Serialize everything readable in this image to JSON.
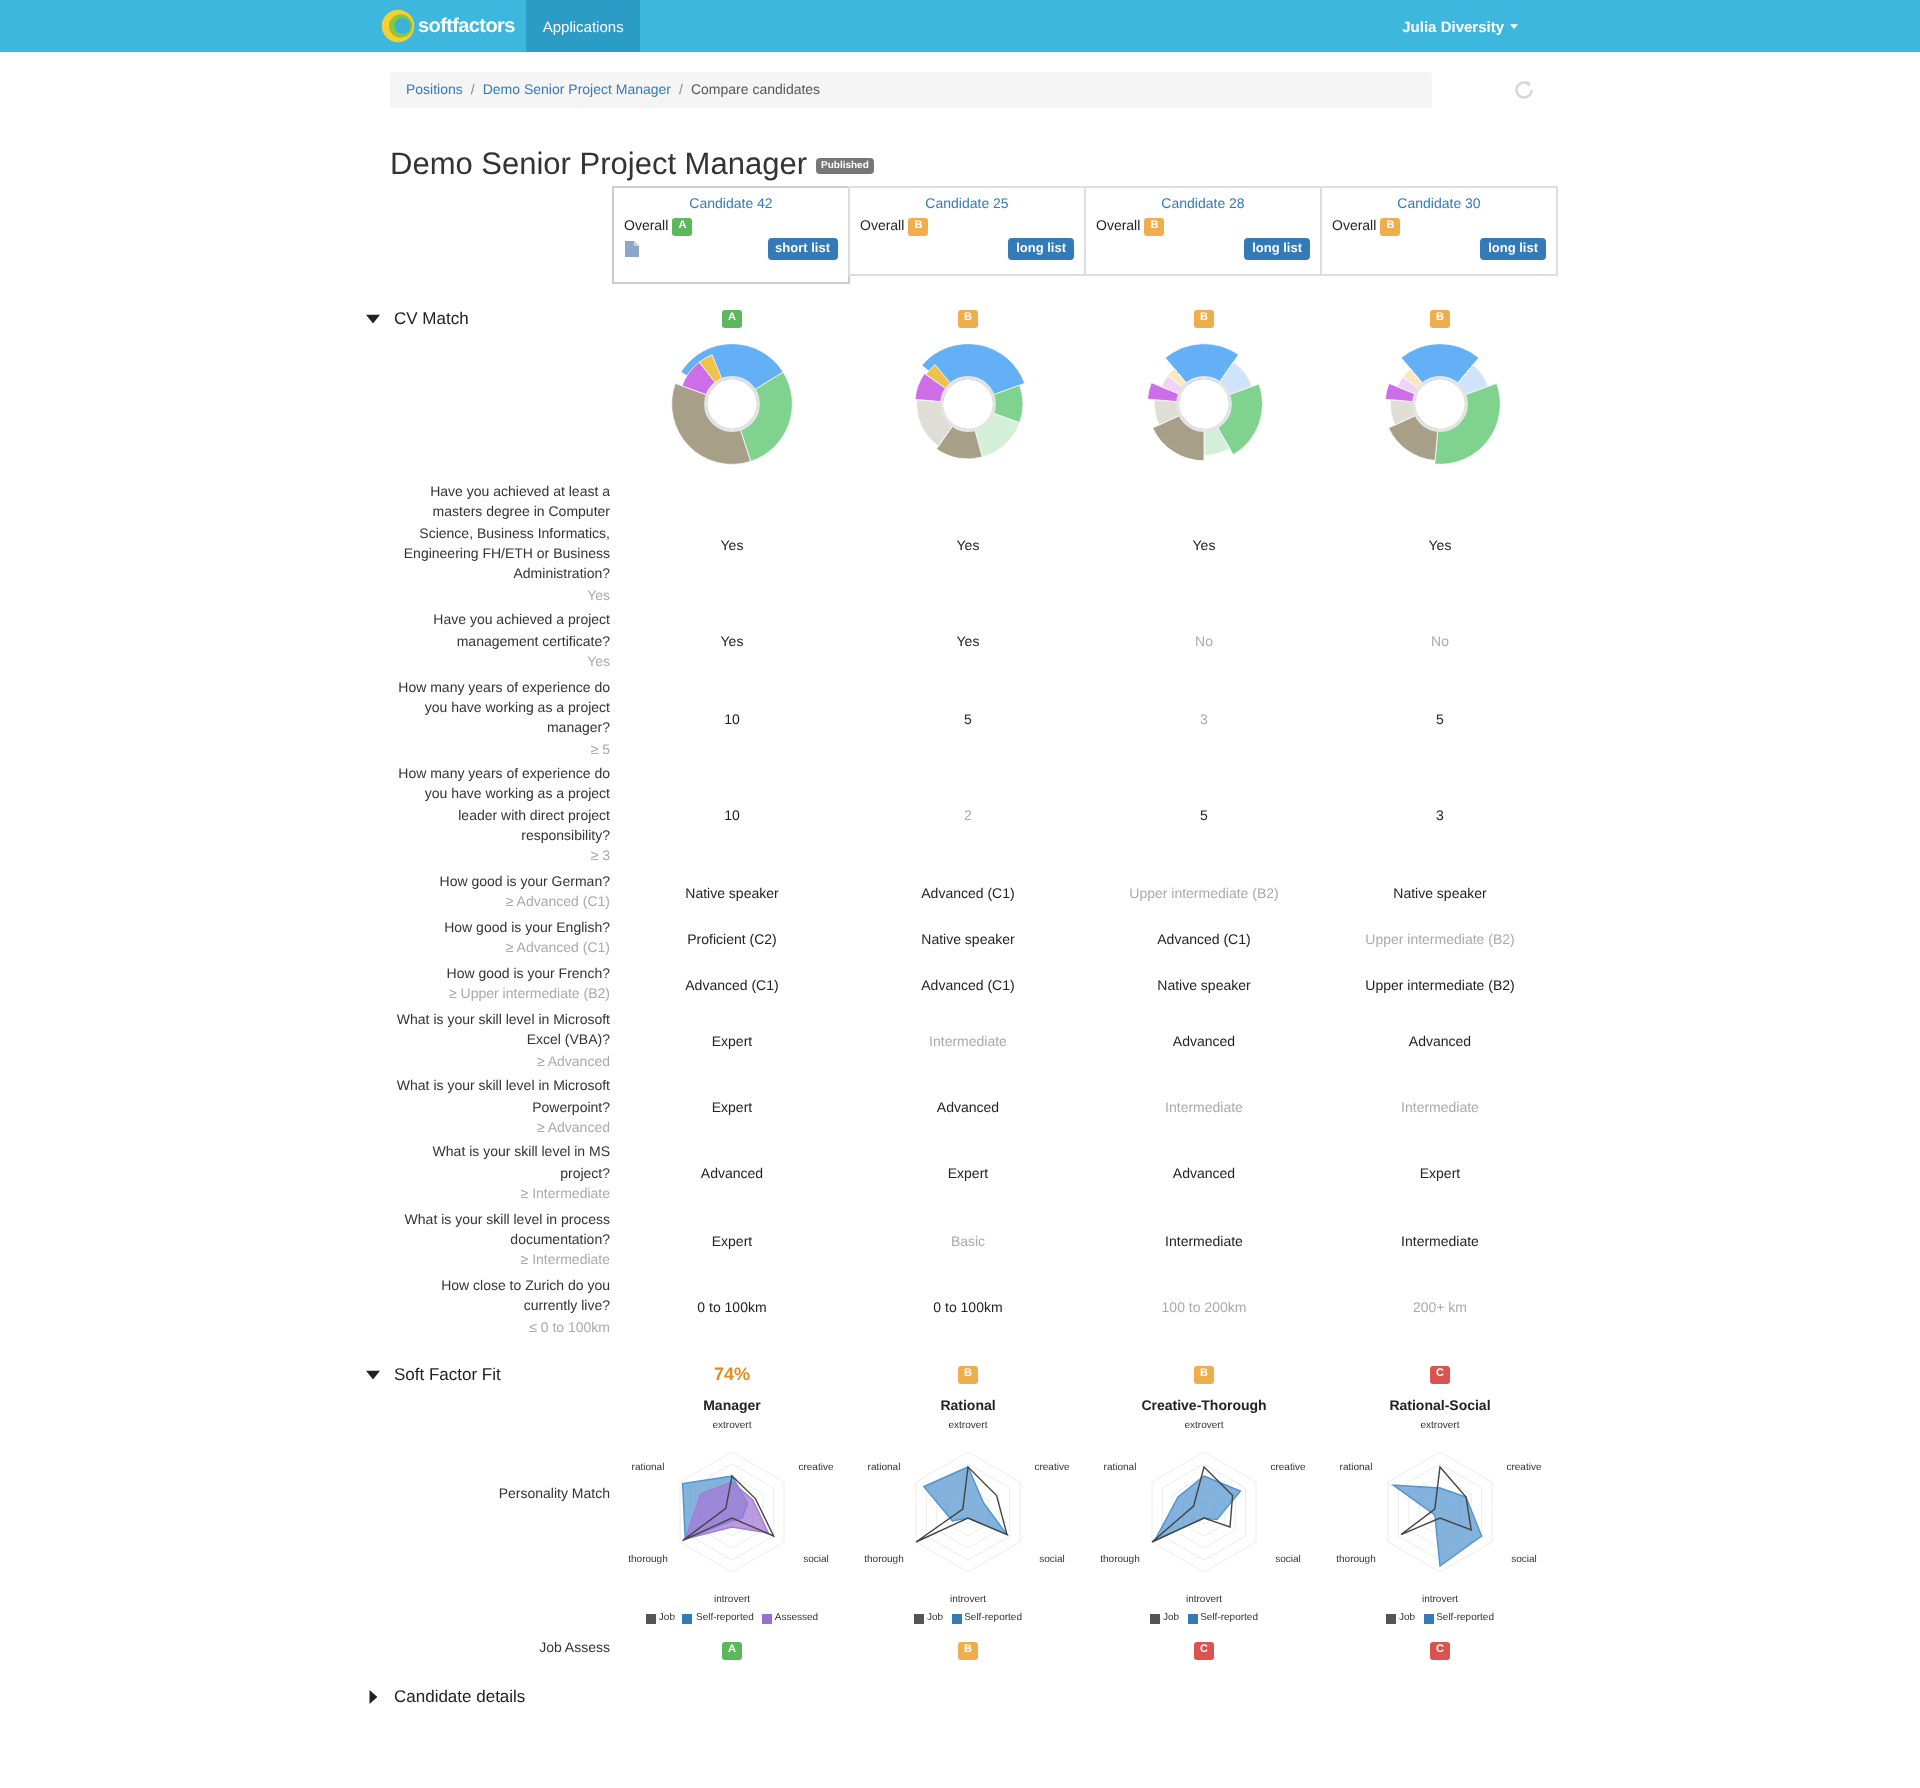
{
  "navbar": {
    "logo_text": "softfactors",
    "nav_items": [
      {
        "label": "Applications",
        "selected": true
      }
    ],
    "user_menu": "Julia Diversity"
  },
  "breadcrumb": {
    "separator": "/",
    "items": [
      {
        "label": "Positions",
        "kind": "link"
      },
      {
        "label": "Demo Senior Project Manager",
        "kind": "link"
      },
      {
        "label": "Compare candidates",
        "kind": "current"
      }
    ]
  },
  "title": "Demo Senior Project Manager",
  "status_badge": "Published",
  "candidates": [
    {
      "name": "Candidate 42",
      "overall_label": "Overall",
      "overall_grade": {
        "text": "A",
        "color": "#5cb85c"
      },
      "has_attachment": true,
      "list_button": "short list",
      "selected": true
    },
    {
      "name": "Candidate 25",
      "overall_label": "Overall",
      "overall_grade": {
        "text": "B",
        "color": "#f0ad4e"
      },
      "has_attachment": false,
      "list_button": "long list",
      "selected": false
    },
    {
      "name": "Candidate 28",
      "overall_label": "Overall",
      "overall_grade": {
        "text": "B",
        "color": "#f0ad4e"
      },
      "has_attachment": false,
      "list_button": "long list",
      "selected": false
    },
    {
      "name": "Candidate 30",
      "overall_label": "Overall",
      "overall_grade": {
        "text": "B",
        "color": "#f0ad4e"
      },
      "has_attachment": false,
      "list_button": "long list",
      "selected": false
    }
  ],
  "cv_match": {
    "title": "CV Match",
    "expanded": true,
    "grades": [
      {
        "text": "A",
        "color": "#5cb85c"
      },
      {
        "text": "B",
        "color": "#f0ad4e"
      },
      {
        "text": "B",
        "color": "#f0ad4e"
      },
      {
        "text": "B",
        "color": "#f0ad4e"
      }
    ],
    "questions": [
      {
        "question": "Have you achieved at least a masters degree in Computer Science, Business Informatics, Engineering FH/ETH or Business Administration?",
        "requirement": "Yes",
        "answers": [
          {
            "text": "Yes",
            "meets": true
          },
          {
            "text": "Yes",
            "meets": true
          },
          {
            "text": "Yes",
            "meets": true
          },
          {
            "text": "Yes",
            "meets": true
          }
        ]
      },
      {
        "question": "Have you achieved a project management certificate?",
        "requirement": "Yes",
        "answers": [
          {
            "text": "Yes",
            "meets": true
          },
          {
            "text": "Yes",
            "meets": true
          },
          {
            "text": "No",
            "meets": false
          },
          {
            "text": "No",
            "meets": false
          }
        ]
      },
      {
        "question": "How many years of experience do you have working as a project manager?",
        "requirement": "≥ 5",
        "answers": [
          {
            "text": "10",
            "meets": true
          },
          {
            "text": "5",
            "meets": true
          },
          {
            "text": "3",
            "meets": false
          },
          {
            "text": "5",
            "meets": true
          }
        ]
      },
      {
        "question": "How many years of experience do you have working as a project leader with direct project responsibility?",
        "requirement": "≥ 3",
        "answers": [
          {
            "text": "10",
            "meets": true
          },
          {
            "text": "2",
            "meets": false
          },
          {
            "text": "5",
            "meets": true
          },
          {
            "text": "3",
            "meets": true
          }
        ]
      },
      {
        "question": "How good is your German?",
        "requirement": "≥ Advanced (C1)",
        "answers": [
          {
            "text": "Native speaker",
            "meets": true
          },
          {
            "text": "Advanced (C1)",
            "meets": true
          },
          {
            "text": "Upper intermediate (B2)",
            "meets": false
          },
          {
            "text": "Native speaker",
            "meets": true
          }
        ]
      },
      {
        "question": "How good is your English?",
        "requirement": "≥ Advanced (C1)",
        "answers": [
          {
            "text": "Proficient (C2)",
            "meets": true
          },
          {
            "text": "Native speaker",
            "meets": true
          },
          {
            "text": "Advanced (C1)",
            "meets": true
          },
          {
            "text": "Upper intermediate (B2)",
            "meets": false
          }
        ]
      },
      {
        "question": "How good is your French?",
        "requirement": "≥ Upper intermediate (B2)",
        "answers": [
          {
            "text": "Advanced (C1)",
            "meets": true
          },
          {
            "text": "Advanced (C1)",
            "meets": true
          },
          {
            "text": "Native speaker",
            "meets": true
          },
          {
            "text": "Upper intermediate (B2)",
            "meets": true
          }
        ]
      },
      {
        "question": "What is your skill level in Microsoft Excel (VBA)?",
        "requirement": "≥ Advanced",
        "answers": [
          {
            "text": "Expert",
            "meets": true
          },
          {
            "text": "Intermediate",
            "meets": false
          },
          {
            "text": "Advanced",
            "meets": true
          },
          {
            "text": "Advanced",
            "meets": true
          }
        ]
      },
      {
        "question": "What is your skill level in Microsoft Powerpoint?",
        "requirement": "≥ Advanced",
        "answers": [
          {
            "text": "Expert",
            "meets": true
          },
          {
            "text": "Advanced",
            "meets": true
          },
          {
            "text": "Intermediate",
            "meets": false
          },
          {
            "text": "Intermediate",
            "meets": false
          }
        ]
      },
      {
        "question": "What is your skill level in MS project?",
        "requirement": "≥ Intermediate",
        "answers": [
          {
            "text": "Advanced",
            "meets": true
          },
          {
            "text": "Expert",
            "meets": true
          },
          {
            "text": "Advanced",
            "meets": true
          },
          {
            "text": "Expert",
            "meets": true
          }
        ]
      },
      {
        "question": "What is your skill level in process documentation?",
        "requirement": "≥ Intermediate",
        "answers": [
          {
            "text": "Expert",
            "meets": true
          },
          {
            "text": "Basic",
            "meets": false
          },
          {
            "text": "Intermediate",
            "meets": true
          },
          {
            "text": "Intermediate",
            "meets": true
          }
        ]
      },
      {
        "question": "How close to Zurich do you currently live?",
        "requirement": "≤ 0 to 100km",
        "answers": [
          {
            "text": "0 to 100km",
            "meets": true
          },
          {
            "text": "0 to 100km",
            "meets": true
          },
          {
            "text": "100 to 200km",
            "meets": false
          },
          {
            "text": "200+ km",
            "meets": false
          }
        ]
      }
    ]
  },
  "soft_factor_fit": {
    "title": "Soft Factor Fit",
    "expanded": true,
    "scores": [
      {
        "kind": "percent",
        "text": "74%"
      },
      {
        "kind": "grade",
        "text": "B",
        "color": "#f0ad4e"
      },
      {
        "kind": "grade",
        "text": "B",
        "color": "#f0ad4e"
      },
      {
        "kind": "grade",
        "text": "C",
        "color": "#d9534f"
      }
    ],
    "personality_label": "Personality Match",
    "charts": [
      {
        "title": "Manager",
        "axes": [
          "extrovert",
          "creative",
          "social",
          "introvert",
          "thorough",
          "rational"
        ],
        "legend": [
          {
            "label": "Job",
            "color": "#555555"
          },
          {
            "label": "Self-reported",
            "color": "#337ab7"
          },
          {
            "label": "Assessed",
            "color": "#9b6fd0"
          }
        ]
      },
      {
        "title": "Rational",
        "axes": [
          "extrovert",
          "creative",
          "social",
          "introvert",
          "thorough",
          "rational"
        ],
        "legend": [
          {
            "label": "Job",
            "color": "#555555"
          },
          {
            "label": "Self-reported",
            "color": "#337ab7"
          }
        ]
      },
      {
        "title": "Creative-Thorough",
        "axes": [
          "extrovert",
          "creative",
          "social",
          "introvert",
          "thorough",
          "rational"
        ],
        "legend": [
          {
            "label": "Job",
            "color": "#555555"
          },
          {
            "label": "Self-reported",
            "color": "#337ab7"
          }
        ]
      },
      {
        "title": "Rational-Social",
        "axes": [
          "extrovert",
          "creative",
          "social",
          "introvert",
          "thorough",
          "rational"
        ],
        "legend": [
          {
            "label": "Job",
            "color": "#555555"
          },
          {
            "label": "Self-reported",
            "color": "#337ab7"
          }
        ]
      }
    ],
    "job_assess_label": "Job Assess",
    "job_assess": [
      {
        "text": "A",
        "color": "#5cb85c"
      },
      {
        "text": "B",
        "color": "#f0ad4e"
      },
      {
        "text": "C",
        "color": "#d9534f"
      },
      {
        "text": "C",
        "color": "#d9534f"
      }
    ]
  },
  "candidate_details": {
    "title": "Candidate details",
    "expanded": false
  }
}
